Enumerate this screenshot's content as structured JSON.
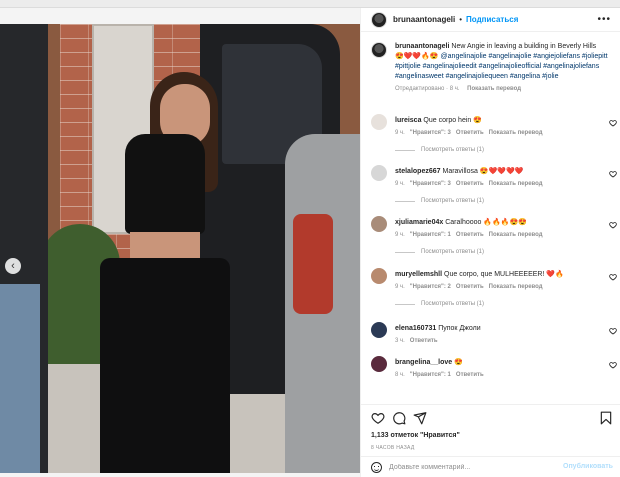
{
  "post": {
    "username": "brunaantonageli",
    "separator": "•",
    "follow_label": "Подписаться",
    "more_label": "•••",
    "carousel_prev": "‹",
    "slides_total": 4,
    "slide_active": 2
  },
  "caption": {
    "username": "brunaantonageli",
    "text": "New Angie in leaving a building in Beverly Hills",
    "emojis": "😍❤️❤️🔥😍",
    "tags": "@angelinajolie #angelinajolie #angiejoliefans #joliepitt #pittjolie #angelinajolieedit #angelinajolieofficial #angelinajoliefans #angelinasweet #angelinajoliequeen #angelina #jolie",
    "meta_edited": "Отредактировано · 8 ч.",
    "meta_translate": "Показать перевод"
  },
  "comments": [
    {
      "username": "lureisca",
      "text": "Que corpo hein 😍",
      "time": "9 ч.",
      "likes": "\"Нравится\": 3",
      "reply": "Ответить",
      "translate": "Показать перевод",
      "replies": "Посмотреть ответы (1)",
      "avatar_color": "#e7e1dc"
    },
    {
      "username": "stelalopez667",
      "text": "Maravillosa 😍❤️❤️❤️❤️",
      "time": "9 ч.",
      "likes": "\"Нравится\": 3",
      "reply": "Ответить",
      "translate": "Показать перевод",
      "replies": "Посмотреть ответы (1)",
      "avatar_color": "#d7d7d7"
    },
    {
      "username": "xjuliamarie04x",
      "text": "Caralhoooo 🔥🔥🔥😍😍",
      "time": "9 ч.",
      "likes": "\"Нравится\": 1",
      "reply": "Ответить",
      "translate": "Показать перевод",
      "replies": "Посмотреть ответы (1)",
      "avatar_color": "#a98c79"
    },
    {
      "username": "muryellemshll",
      "text": "Que corpo, que MULHEEEEER! ❤️🔥",
      "time": "9 ч.",
      "likes": "\"Нравится\": 2",
      "reply": "Ответить",
      "translate": "Показать перевод",
      "replies": "Посмотреть ответы (1)",
      "avatar_color": "#b88a6e"
    },
    {
      "username": "elena160731",
      "text": "Пупок Джоли",
      "time": "3 ч.",
      "likes": "",
      "reply": "Ответить",
      "translate": "",
      "replies": "",
      "avatar_color": "#2b3a55"
    },
    {
      "username": "brangelina__love",
      "text": "😍",
      "time": "8 ч.",
      "likes": "\"Нравится\": 1",
      "reply": "Ответить",
      "translate": "",
      "replies": "",
      "avatar_color": "#5a2b3d"
    }
  ],
  "footer": {
    "likes": "1,133 отметок \"Нравится\"",
    "posted": "8 ЧАСОВ НАЗАД",
    "add_comment_placeholder": "Добавьте комментарий...",
    "publish_label": "Опубликовать"
  },
  "icons": {
    "like": "heart-icon",
    "comment": "comment-icon",
    "share": "share-icon",
    "save": "bookmark-icon",
    "emoji": "emoji-icon",
    "comment_like": "heart-icon"
  },
  "colors": {
    "link_blue": "#0095f6",
    "tag_blue": "#00376b",
    "muted": "#8e8e8e",
    "publish_disabled": "#b2dffc"
  }
}
